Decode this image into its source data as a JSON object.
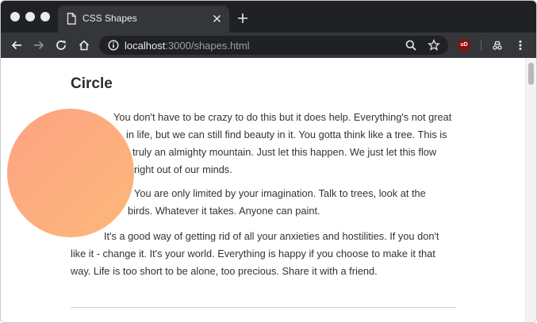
{
  "browser": {
    "tab": {
      "title": "CSS Shapes",
      "icon": "page-icon"
    },
    "address_bar": {
      "host": "localhost",
      "path": ":3000/shapes.html"
    },
    "extension_badge": "uD"
  },
  "page": {
    "heading": "Circle",
    "shape_gradient": [
      "#fda282",
      "#fcb87a"
    ],
    "paragraphs": [
      {
        "lines": [
          "You don't have to be crazy to do this but it does help. Everything's not great",
          "in life, but we can still find beauty in it. You gotta think like a tree. This is",
          "truly an almighty mountain. Just let this happen. We just let this flow",
          "right out of our minds."
        ]
      },
      {
        "lines": [
          "You are only limited by your imagination. Talk to trees, look at the",
          "birds. Whatever it takes. Anyone can paint."
        ]
      },
      {
        "lines": [
          "It's a good way of getting rid of all your anxieties and hostilities. If you don't",
          "like it - change it. It's your world. Everything is happy if you choose to make it that",
          "way. Life is too short to be alone, too precious. Share it with a friend."
        ]
      }
    ]
  },
  "colors": {
    "tab_strip": "#202124",
    "toolbar": "#35363a",
    "text": "#333333"
  }
}
